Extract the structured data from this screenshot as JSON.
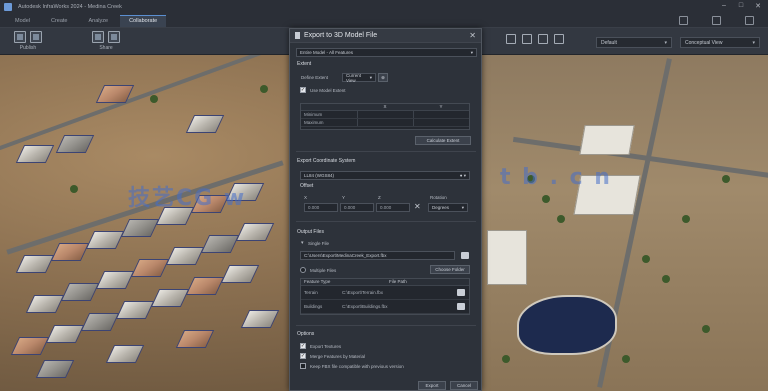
{
  "titlebar": {
    "title": "Autodesk InfraWorks 2024 - Medina Creek",
    "minimize": "–",
    "maximize": "□",
    "close": "✕"
  },
  "tabs": [
    {
      "label": "Model"
    },
    {
      "label": "Create"
    },
    {
      "label": "Analyze"
    },
    {
      "label": "Collaborate",
      "active": true
    }
  ],
  "ribbon": {
    "groups": [
      {
        "label": "Publish"
      },
      {
        "label": "Share"
      }
    ],
    "dropdown_left": {
      "value": "Default"
    },
    "dropdown_right": {
      "value": "Conceptual View"
    }
  },
  "dialog": {
    "title": "Export to 3D Model File",
    "preset": "Entire Model - All Features",
    "section_extent": "Extent",
    "extent_label": "Define Extent",
    "extent_value": "Current View",
    "use_model_extent": "Use Model Extent",
    "extent_grid": {
      "headers": [
        "",
        "X",
        "Y"
      ],
      "rows": [
        [
          "Minimum",
          "",
          ""
        ],
        [
          "Maximum",
          "",
          ""
        ]
      ]
    },
    "calc_extent_btn": "Calculate Extent",
    "section_coord": "Export Coordinate System",
    "coord_value": "LL84 (WGS84)",
    "section_offset": "Offset",
    "offset_labels": [
      "X",
      "Y",
      "Z",
      "Rotation"
    ],
    "offset_values": [
      "0.000",
      "0.000",
      "0.000"
    ],
    "offset_unit": "Degrees",
    "section_output": "Output Files",
    "single_file_label": "Single File",
    "single_file_path": "C:\\Users\\Export\\MedinaCreek_Export.fbx",
    "multi_file_label": "Multiple Files",
    "choose_folder_btn": "Choose Folder",
    "file_grid": {
      "headers": [
        "Feature Type",
        "File Path"
      ],
      "rows": [
        [
          "Terrain",
          "C:\\Export\\Terrain.fbx"
        ],
        [
          "Buildings",
          "C:\\Export\\Buildings.fbx"
        ]
      ]
    },
    "section_options": "Options",
    "options": [
      {
        "label": "Export Textures",
        "checked": true
      },
      {
        "label": "Merge Features by Material",
        "checked": true
      },
      {
        "label": "Keep FBX file compatible with previous version",
        "checked": false
      }
    ],
    "export_btn": "Export",
    "cancel_btn": "Cancel"
  },
  "watermark": {
    "left": "技艺CG w",
    "right": "t b . c n"
  },
  "colors": {
    "accent": "#5b8fd1",
    "dialog_bg": "#2d323a",
    "ribbon_bg": "#333841"
  }
}
